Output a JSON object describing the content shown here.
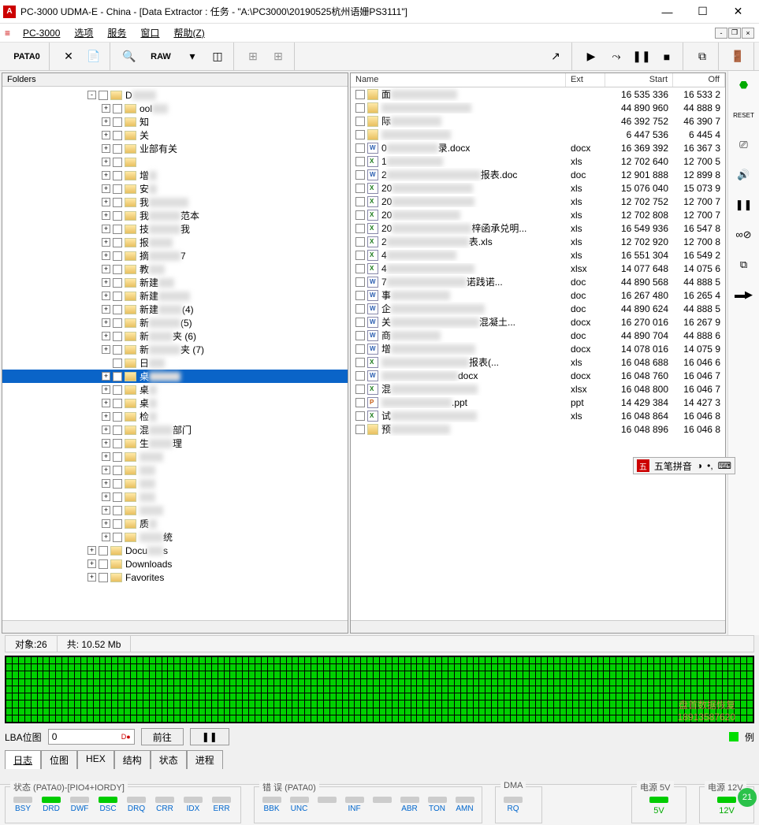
{
  "window": {
    "title": "PC-3000 UDMA-E - China - [Data Extractor : 任务 - \"A:\\PC3000\\20190525杭州语姗PS3111\"]"
  },
  "menu": {
    "app": "PC-3000",
    "items": [
      "选项",
      "服务",
      "窗口",
      "帮助(Z)"
    ]
  },
  "toolbar": {
    "pata": "PATA0",
    "raw": "RAW"
  },
  "left_pane": {
    "header": "Folders",
    "tree": [
      {
        "indent": 6,
        "exp": "-",
        "label": "D",
        "blur": 30
      },
      {
        "indent": 7,
        "exp": "+",
        "label": "ool",
        "blur": 20
      },
      {
        "indent": 7,
        "exp": "+",
        "label": "知",
        "pre": 30
      },
      {
        "indent": 7,
        "exp": "+",
        "label": "关",
        "pre": 30
      },
      {
        "indent": 7,
        "exp": "+",
        "label": "业部有关",
        "pre": 40
      },
      {
        "indent": 7,
        "exp": "+",
        "label": "",
        "pre": 20
      },
      {
        "indent": 7,
        "exp": "+",
        "label": "增",
        "pre": 0,
        "blur": 10
      },
      {
        "indent": 7,
        "exp": "+",
        "label": "安",
        "blur": 10
      },
      {
        "indent": 7,
        "exp": "+",
        "label": "我",
        "blur": 50
      },
      {
        "indent": 7,
        "exp": "+",
        "label": "我",
        "suffix": "范本",
        "blur": 40
      },
      {
        "indent": 7,
        "exp": "+",
        "label": "技",
        "suffix": "我",
        "blur": 40
      },
      {
        "indent": 7,
        "exp": "+",
        "label": "报",
        "blur": 30
      },
      {
        "indent": 7,
        "exp": "+",
        "label": "摘",
        "suffix": "7",
        "blur": 40
      },
      {
        "indent": 7,
        "exp": "+",
        "label": "教",
        "blur": 20
      },
      {
        "indent": 7,
        "exp": "+",
        "label": "新建",
        "blur": 20
      },
      {
        "indent": 7,
        "exp": "+",
        "label": "新建",
        "blur": 40
      },
      {
        "indent": 7,
        "exp": "+",
        "label": "新建",
        "suffix": "(4)",
        "blur": 30
      },
      {
        "indent": 7,
        "exp": "+",
        "label": "新",
        "suffix": "(5)",
        "blur": 40
      },
      {
        "indent": 7,
        "exp": "+",
        "label": "新",
        "suffix": "夹 (6)",
        "blur": 30
      },
      {
        "indent": 7,
        "exp": "+",
        "label": "新",
        "suffix": "夹 (7)",
        "blur": 40
      },
      {
        "indent": 7,
        "exp": " ",
        "label": "日",
        "blur": 20
      },
      {
        "indent": 7,
        "exp": "+",
        "label": "桌",
        "blur": 40,
        "selected": true
      },
      {
        "indent": 7,
        "exp": "+",
        "label": "桌",
        "blur": 10
      },
      {
        "indent": 7,
        "exp": "+",
        "label": "桌",
        "blur": 10
      },
      {
        "indent": 7,
        "exp": "+",
        "label": "检",
        "blur": 10
      },
      {
        "indent": 7,
        "exp": "+",
        "label": "混",
        "suffix": "部门",
        "blur": 30
      },
      {
        "indent": 7,
        "exp": "+",
        "label": "生",
        "suffix": "理",
        "blur": 30
      },
      {
        "indent": 7,
        "exp": "+",
        "label": "",
        "blur": 30
      },
      {
        "indent": 7,
        "exp": "+",
        "label": "",
        "blur": 20
      },
      {
        "indent": 7,
        "exp": "+",
        "label": "",
        "blur": 20
      },
      {
        "indent": 7,
        "exp": "+",
        "label": "",
        "blur": 20
      },
      {
        "indent": 7,
        "exp": "+",
        "label": "",
        "blur": 30
      },
      {
        "indent": 7,
        "exp": "+",
        "label": "质",
        "blur": 10
      },
      {
        "indent": 7,
        "exp": "+",
        "label": "",
        "suffix": "统",
        "blur": 30
      },
      {
        "indent": 6,
        "exp": "+",
        "label": "Docu",
        "suffix": "s",
        "blur": 20
      },
      {
        "indent": 6,
        "exp": "+",
        "label": "Downloads"
      },
      {
        "indent": 6,
        "exp": "+",
        "label": "Favorites"
      }
    ]
  },
  "right_pane": {
    "headers": {
      "name": "Name",
      "ext": "Ext",
      "start": "Start",
      "off": "Off"
    },
    "rows": [
      {
        "icon": "folder",
        "name": "面",
        "ext": "",
        "start": "16 535 336",
        "off": "16 533 2"
      },
      {
        "icon": "folder",
        "name": "",
        "ext": "",
        "start": "44 890 960",
        "off": "44 888 9"
      },
      {
        "icon": "folder",
        "name": "际",
        "ext": "",
        "start": "46 392 752",
        "off": "46 390 7"
      },
      {
        "icon": "folder",
        "name": "",
        "ext": "",
        "start": "6 447 536",
        "off": "6 445 4"
      },
      {
        "icon": "doc",
        "name": "0",
        "suffix": "录.docx",
        "ext": "docx",
        "start": "16 369 392",
        "off": "16 367 3"
      },
      {
        "icon": "xls",
        "name": "1",
        "ext": "xls",
        "start": "12 702 640",
        "off": "12 700 5"
      },
      {
        "icon": "doc",
        "name": "2",
        "suffix": "报表.doc",
        "ext": "doc",
        "start": "12 901 888",
        "off": "12 899 8"
      },
      {
        "icon": "xls",
        "name": "20",
        "ext": "xls",
        "start": "15 076 040",
        "off": "15 073 9"
      },
      {
        "icon": "xls",
        "name": "20",
        "ext": "xls",
        "start": "12 702 752",
        "off": "12 700 7"
      },
      {
        "icon": "xls",
        "name": "20",
        "ext": "xls",
        "start": "12 702 808",
        "off": "12 700 7"
      },
      {
        "icon": "xls",
        "name": "20",
        "suffix": "梓函承兑明...",
        "ext": "xls",
        "start": "16 549 936",
        "off": "16 547 8"
      },
      {
        "icon": "xls",
        "name": "2",
        "suffix": "表.xls",
        "ext": "xls",
        "start": "12 702 920",
        "off": "12 700 8"
      },
      {
        "icon": "xls",
        "name": "4",
        "ext": "xls",
        "start": "16 551 304",
        "off": "16 549 2"
      },
      {
        "icon": "xls",
        "name": "4",
        "ext": "xlsx",
        "start": "14 077 648",
        "off": "14 075 6"
      },
      {
        "icon": "doc",
        "name": "7",
        "suffix": "诺践诺...",
        "ext": "doc",
        "start": "44 890 568",
        "off": "44 888 5"
      },
      {
        "icon": "doc",
        "name": "事",
        "ext": "doc",
        "start": "16 267 480",
        "off": "16 265 4"
      },
      {
        "icon": "doc",
        "name": "企",
        "ext": "doc",
        "start": "44 890 624",
        "off": "44 888 5"
      },
      {
        "icon": "doc",
        "name": "关",
        "suffix": "混凝土...",
        "ext": "docx",
        "start": "16 270 016",
        "off": "16 267 9"
      },
      {
        "icon": "doc",
        "name": "商",
        "ext": "doc",
        "start": "44 890 704",
        "off": "44 888 6"
      },
      {
        "icon": "doc",
        "name": "增",
        "ext": "docx",
        "start": "14 078 016",
        "off": "14 075 9"
      },
      {
        "icon": "xls",
        "name": "",
        "suffix": "报表(...",
        "ext": "xls",
        "start": "16 048 688",
        "off": "16 046 6"
      },
      {
        "icon": "doc",
        "name": "",
        "suffix": "docx",
        "ext": "docx",
        "start": "16 048 760",
        "off": "16 046 7"
      },
      {
        "icon": "xls",
        "name": "混",
        "ext": "xlsx",
        "start": "16 048 800",
        "off": "16 046 7"
      },
      {
        "icon": "ppt",
        "name": "",
        "suffix": ".ppt",
        "ext": "ppt",
        "start": "14 429 384",
        "off": "14 427 3"
      },
      {
        "icon": "xls",
        "name": "试",
        "ext": "xls",
        "start": "16 048 864",
        "off": "16 046 8"
      },
      {
        "icon": "folder",
        "name": "预",
        "ext": "",
        "start": "16 048 896",
        "off": "16 046 8"
      }
    ]
  },
  "ime": {
    "label": "五笔拼音"
  },
  "status": {
    "objects_label": "对象:",
    "objects": "26",
    "total_label": "共:",
    "total": "10.52 Mb"
  },
  "lba": {
    "label": "LBA位图",
    "value": "0",
    "go": "前往",
    "legend": "例"
  },
  "tabs": [
    "日志",
    "位图",
    "HEX",
    "结构",
    "状态",
    "进程"
  ],
  "bottom": {
    "state_title": "状态 (PATA0)-[PIO4+IORDY]",
    "state_sigs": [
      "BSY",
      "DRD",
      "DWF",
      "DSC",
      "DRQ",
      "CRR",
      "IDX",
      "ERR"
    ],
    "state_on": [
      false,
      true,
      false,
      true,
      false,
      false,
      false,
      false
    ],
    "err_title": "错 误 (PATA0)",
    "err_sigs": [
      "BBK",
      "UNC",
      "",
      "INF",
      "",
      "ABR",
      "TON",
      "AMN"
    ],
    "dma_title": "DMA",
    "dma_sig": "RQ",
    "p5_title": "电源 5V",
    "p5": "5V",
    "p12_title": "电源 12V",
    "p12": "12V"
  },
  "watermark": {
    "line1": "盘首数据恢复",
    "line2": "18913587620"
  },
  "badge": "21"
}
